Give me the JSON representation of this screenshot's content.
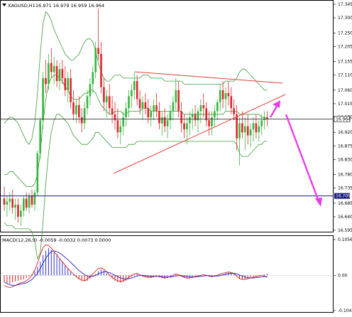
{
  "header": {
    "symbol": "XAGUSD,H1",
    "quote": "16.971 16.979 16.959 16.964"
  },
  "colors": {
    "bull": "#35b53b",
    "bear": "#e0222a",
    "bollinger": "#3a9a3a",
    "price_line": "#333333",
    "support_line": "#1a1a7e",
    "trendline": "#e83c3c",
    "forecast_arrow": "#e43ee8",
    "macd_line": "#e02020",
    "signal_line": "#2020c0",
    "hist_pos": "#3030d0",
    "hist_neg": "#d02020"
  },
  "chart_data": [
    {
      "type": "candlestick",
      "title": "XAGUSD,H1",
      "y_axis_ticks": [
        "17.345",
        "17.300",
        "17.250",
        "17.205",
        "17.155",
        "17.110",
        "17.060",
        "17.015",
        "16.970",
        "16.920",
        "16.875",
        "16.830",
        "16.780",
        "16.735",
        "16.685",
        "16.640",
        "16.595"
      ],
      "ylim": [
        16.595,
        17.345
      ],
      "current_price": 16.964,
      "current_price_label": "16.964",
      "support_level": 16.709,
      "support_label": "16.709",
      "candles_approx": [
        [
          16.7,
          16.74,
          16.66,
          16.68
        ],
        [
          16.68,
          16.71,
          16.64,
          16.69
        ],
        [
          16.69,
          16.72,
          16.66,
          16.7
        ],
        [
          16.7,
          16.73,
          16.65,
          16.67
        ],
        [
          16.67,
          16.7,
          16.63,
          16.68
        ],
        [
          16.68,
          16.7,
          16.62,
          16.64
        ],
        [
          16.64,
          16.68,
          16.61,
          16.66
        ],
        [
          16.66,
          16.71,
          16.64,
          16.7
        ],
        [
          16.7,
          16.72,
          16.66,
          16.67
        ],
        [
          16.67,
          16.72,
          16.65,
          16.71
        ],
        [
          16.71,
          16.73,
          16.67,
          16.68
        ],
        [
          16.68,
          16.73,
          16.66,
          16.72
        ],
        [
          16.72,
          16.86,
          16.71,
          16.85
        ],
        [
          16.85,
          16.97,
          16.83,
          16.96
        ],
        [
          16.96,
          17.12,
          16.93,
          17.1
        ],
        [
          17.1,
          17.16,
          17.05,
          17.08
        ],
        [
          17.08,
          17.18,
          17.06,
          17.15
        ],
        [
          17.15,
          17.2,
          17.1,
          17.12
        ],
        [
          17.12,
          17.17,
          17.08,
          17.14
        ],
        [
          17.14,
          17.16,
          17.07,
          17.09
        ],
        [
          17.09,
          17.15,
          17.06,
          17.13
        ],
        [
          17.13,
          17.16,
          17.08,
          17.1
        ],
        [
          17.1,
          17.14,
          17.04,
          17.06
        ],
        [
          17.06,
          17.12,
          17.02,
          17.1
        ],
        [
          17.1,
          17.13,
          17.0,
          17.02
        ],
        [
          17.02,
          17.06,
          16.96,
          16.98
        ],
        [
          16.98,
          17.03,
          16.95,
          17.01
        ],
        [
          17.01,
          17.04,
          16.95,
          16.97
        ],
        [
          16.97,
          17.0,
          16.92,
          16.95
        ],
        [
          16.95,
          17.02,
          16.93,
          17.0
        ],
        [
          17.0,
          17.06,
          16.98,
          17.04
        ],
        [
          17.04,
          17.1,
          17.01,
          17.08
        ],
        [
          17.08,
          17.14,
          17.05,
          17.12
        ],
        [
          17.12,
          17.22,
          17.1,
          17.2
        ],
        [
          17.2,
          17.33,
          17.16,
          17.18
        ],
        [
          17.18,
          17.22,
          17.05,
          17.07
        ],
        [
          17.07,
          17.1,
          16.99,
          17.02
        ],
        [
          17.02,
          17.06,
          16.97,
          17.04
        ],
        [
          17.04,
          17.08,
          16.98,
          17.0
        ],
        [
          17.0,
          17.04,
          16.95,
          16.98
        ],
        [
          16.98,
          17.02,
          16.93,
          16.96
        ],
        [
          16.96,
          17.0,
          16.9,
          16.92
        ],
        [
          16.92,
          16.96,
          16.88,
          16.94
        ],
        [
          16.94,
          16.99,
          16.91,
          16.97
        ],
        [
          16.97,
          17.02,
          16.94,
          17.0
        ],
        [
          17.0,
          17.06,
          16.97,
          17.04
        ],
        [
          17.04,
          17.08,
          17.0,
          17.06
        ],
        [
          17.06,
          17.12,
          17.03,
          17.09
        ],
        [
          17.09,
          17.11,
          17.01,
          17.03
        ],
        [
          17.03,
          17.06,
          16.98,
          17.0
        ],
        [
          17.0,
          17.04,
          16.96,
          17.02
        ],
        [
          17.02,
          17.05,
          16.98,
          17.0
        ],
        [
          17.0,
          17.03,
          16.95,
          16.97
        ],
        [
          16.97,
          17.01,
          16.94,
          16.99
        ],
        [
          16.99,
          17.03,
          16.96,
          17.01
        ],
        [
          17.01,
          17.05,
          16.97,
          16.99
        ],
        [
          16.99,
          17.02,
          16.93,
          16.95
        ],
        [
          16.95,
          16.99,
          16.91,
          16.97
        ],
        [
          16.97,
          17.0,
          16.92,
          16.94
        ],
        [
          16.94,
          16.98,
          16.9,
          16.96
        ],
        [
          16.96,
          17.01,
          16.93,
          16.99
        ],
        [
          16.99,
          17.04,
          16.96,
          17.02
        ],
        [
          17.02,
          17.1,
          16.99,
          17.06
        ],
        [
          17.06,
          17.09,
          16.97,
          16.99
        ],
        [
          16.99,
          17.02,
          16.92,
          16.95
        ],
        [
          16.95,
          16.98,
          16.9,
          16.93
        ],
        [
          16.93,
          16.97,
          16.88,
          16.95
        ],
        [
          16.95,
          16.99,
          16.91,
          16.97
        ],
        [
          16.97,
          17.0,
          16.93,
          16.98
        ],
        [
          16.98,
          17.01,
          16.94,
          16.96
        ],
        [
          16.96,
          17.0,
          16.92,
          16.99
        ],
        [
          16.99,
          17.03,
          16.95,
          17.01
        ],
        [
          17.01,
          17.05,
          16.97,
          17.0
        ],
        [
          17.0,
          17.02,
          16.94,
          16.96
        ],
        [
          16.96,
          16.99,
          16.91,
          16.94
        ],
        [
          16.94,
          16.99,
          16.91,
          16.97
        ],
        [
          16.97,
          17.01,
          16.94,
          16.99
        ],
        [
          16.99,
          17.03,
          16.96,
          17.02
        ],
        [
          17.02,
          17.08,
          16.99,
          17.06
        ],
        [
          17.06,
          17.09,
          17.0,
          17.03
        ],
        [
          17.03,
          17.07,
          16.99,
          17.05
        ],
        [
          17.05,
          17.09,
          17.01,
          17.04
        ],
        [
          17.04,
          17.07,
          16.98,
          17.0
        ],
        [
          17.0,
          17.03,
          16.96,
          16.98
        ],
        [
          16.98,
          17.01,
          16.86,
          16.9
        ],
        [
          16.9,
          16.97,
          16.81,
          16.95
        ],
        [
          16.95,
          16.99,
          16.9,
          16.92
        ],
        [
          16.92,
          16.97,
          16.86,
          16.94
        ],
        [
          16.94,
          16.98,
          16.88,
          16.91
        ],
        [
          16.91,
          16.95,
          16.87,
          16.93
        ],
        [
          16.93,
          16.97,
          16.89,
          16.95
        ],
        [
          16.95,
          16.98,
          16.9,
          16.92
        ],
        [
          16.92,
          16.96,
          16.89,
          16.94
        ],
        [
          16.94,
          16.98,
          16.91,
          16.96
        ],
        [
          16.96,
          16.99,
          16.93,
          16.97
        ],
        [
          16.97,
          16.99,
          16.94,
          16.964
        ]
      ],
      "bollinger_upper_approx": [
        16.95,
        16.96,
        16.97,
        16.97,
        16.96,
        16.95,
        16.93,
        16.91,
        16.89,
        16.88,
        16.9,
        16.95,
        17.05,
        17.18,
        17.28,
        17.32,
        17.31,
        17.29,
        17.26,
        17.24,
        17.22,
        17.2,
        17.18,
        17.17,
        17.16,
        17.16,
        17.17,
        17.18,
        17.2,
        17.22,
        17.23,
        17.23,
        17.22,
        17.19,
        17.15,
        17.12,
        17.1,
        17.09,
        17.09,
        17.1,
        17.11,
        17.11,
        17.11,
        17.1,
        17.1,
        17.1,
        17.1,
        17.1,
        17.1,
        17.1,
        17.11,
        17.11,
        17.11,
        17.1,
        17.1,
        17.1,
        17.1,
        17.1,
        17.09,
        17.09,
        17.09,
        17.09,
        17.09,
        17.09,
        17.09,
        17.08,
        17.08,
        17.08,
        17.08,
        17.08,
        17.08,
        17.08,
        17.08,
        17.08,
        17.08,
        17.08,
        17.08,
        17.08,
        17.08,
        17.08,
        17.09,
        17.09,
        17.09,
        17.09,
        17.1,
        17.12,
        17.13,
        17.13,
        17.12,
        17.11,
        17.1,
        17.09,
        17.08,
        17.07,
        17.06,
        17.06
      ],
      "bollinger_lower_approx": [
        16.62,
        16.61,
        16.61,
        16.61,
        16.6,
        16.6,
        16.6,
        16.6,
        16.6,
        16.6,
        16.59,
        16.56,
        16.5,
        16.52,
        16.62,
        16.75,
        16.85,
        16.92,
        16.96,
        16.98,
        16.98,
        16.97,
        16.96,
        16.95,
        16.93,
        16.91,
        16.9,
        16.89,
        16.88,
        16.88,
        16.88,
        16.89,
        16.9,
        16.92,
        16.92,
        16.91,
        16.9,
        16.89,
        16.88,
        16.87,
        16.87,
        16.87,
        16.87,
        16.87,
        16.87,
        16.88,
        16.88,
        16.88,
        16.89,
        16.89,
        16.89,
        16.89,
        16.89,
        16.89,
        16.89,
        16.89,
        16.89,
        16.89,
        16.89,
        16.89,
        16.89,
        16.89,
        16.89,
        16.89,
        16.89,
        16.89,
        16.89,
        16.89,
        16.89,
        16.89,
        16.89,
        16.89,
        16.89,
        16.89,
        16.89,
        16.89,
        16.89,
        16.89,
        16.89,
        16.89,
        16.89,
        16.89,
        16.89,
        16.89,
        16.88,
        16.85,
        16.84,
        16.84,
        16.84,
        16.85,
        16.86,
        16.87,
        16.88,
        16.88,
        16.89,
        16.89
      ],
      "bollinger_middle_approx": [
        16.78,
        16.78,
        16.79,
        16.79,
        16.78,
        16.77,
        16.76,
        16.75,
        16.74,
        16.74,
        16.74,
        16.75,
        16.78,
        16.85,
        16.95,
        17.03,
        17.08,
        17.1,
        17.11,
        17.11,
        17.1,
        17.09,
        17.07,
        17.06,
        17.04,
        17.03,
        17.03,
        17.03,
        17.04,
        17.05,
        17.05,
        17.06,
        17.06,
        17.05,
        17.03,
        17.01,
        17.0,
        16.99,
        16.98,
        16.98,
        16.99,
        16.99,
        16.99,
        16.98,
        16.98,
        16.99,
        16.99,
        16.99,
        16.99,
        16.99,
        17.0,
        17.0,
        17.0,
        16.99,
        16.99,
        16.99,
        16.99,
        16.99,
        16.99,
        16.99,
        16.99,
        16.99,
        16.99,
        16.99,
        16.99,
        16.98,
        16.98,
        16.98,
        16.98,
        16.98,
        16.98,
        16.98,
        16.98,
        16.98,
        16.98,
        16.98,
        16.98,
        16.98,
        16.98,
        16.98,
        16.99,
        16.99,
        16.99,
        16.99,
        16.99,
        16.98,
        16.98,
        16.98,
        16.98,
        16.98,
        16.98,
        16.98,
        16.98,
        16.97,
        16.97,
        16.97
      ]
    },
    {
      "type": "macd",
      "title": "MACD(12,26,9) -0.0059 -0.0032 0.0073 0.0000",
      "y_axis_ticks": [
        "0.1056",
        "0.00",
        "-0.1042"
      ],
      "ylim": [
        -0.1042,
        0.1056
      ],
      "zero_label": "0.00",
      "histogram_approx": [
        -0.02,
        -0.022,
        -0.024,
        -0.02,
        -0.018,
        -0.016,
        -0.014,
        -0.012,
        -0.008,
        -0.004,
        0.004,
        0.012,
        0.025,
        0.04,
        0.06,
        0.072,
        0.08,
        0.075,
        0.068,
        0.06,
        0.05,
        0.04,
        0.03,
        0.02,
        0.01,
        0.002,
        -0.006,
        -0.012,
        -0.016,
        -0.018,
        -0.016,
        -0.01,
        -0.004,
        0.004,
        0.012,
        0.018,
        0.014,
        0.006,
        -0.002,
        -0.01,
        -0.016,
        -0.02,
        -0.022,
        -0.02,
        -0.016,
        -0.01,
        -0.004,
        0.002,
        0.004,
        0.0,
        -0.004,
        -0.006,
        -0.008,
        -0.008,
        -0.006,
        -0.004,
        -0.006,
        -0.008,
        -0.01,
        -0.008,
        -0.006,
        -0.002,
        0.002,
        0.0,
        -0.004,
        -0.008,
        -0.01,
        -0.01,
        -0.008,
        -0.006,
        -0.004,
        -0.002,
        0.0,
        -0.002,
        -0.004,
        -0.006,
        -0.004,
        -0.002,
        0.002,
        0.004,
        0.006,
        0.008,
        0.006,
        0.004,
        -0.004,
        -0.01,
        -0.012,
        -0.012,
        -0.01,
        -0.008,
        -0.006,
        -0.004,
        -0.002,
        0.0,
        0.002,
        0.004
      ],
      "macd_line_approx": [
        -0.03,
        -0.034,
        -0.036,
        -0.034,
        -0.03,
        -0.026,
        -0.022,
        -0.02,
        -0.016,
        -0.01,
        0.0,
        0.015,
        0.035,
        0.06,
        0.082,
        0.09,
        0.088,
        0.08,
        0.07,
        0.06,
        0.05,
        0.04,
        0.03,
        0.02,
        0.012,
        0.004,
        -0.004,
        -0.01,
        -0.014,
        -0.016,
        -0.012,
        -0.004,
        0.004,
        0.012,
        0.02,
        0.022,
        0.018,
        0.01,
        0.002,
        -0.006,
        -0.012,
        -0.016,
        -0.018,
        -0.016,
        -0.012,
        -0.006,
        0.0,
        0.004,
        0.006,
        0.002,
        -0.002,
        -0.004,
        -0.006,
        -0.006,
        -0.004,
        -0.002,
        -0.004,
        -0.006,
        -0.008,
        -0.006,
        -0.004,
        0.0,
        0.004,
        0.002,
        -0.002,
        -0.006,
        -0.008,
        -0.008,
        -0.006,
        -0.004,
        -0.002,
        0.0,
        0.002,
        0.0,
        -0.002,
        -0.004,
        -0.002,
        0.0,
        0.004,
        0.006,
        0.008,
        0.01,
        0.008,
        0.006,
        -0.002,
        -0.01,
        -0.012,
        -0.012,
        -0.01,
        -0.008,
        -0.006,
        -0.004,
        -0.002,
        0.0,
        -0.002,
        -0.006
      ],
      "signal_line_approx": [
        -0.02,
        -0.024,
        -0.028,
        -0.03,
        -0.03,
        -0.028,
        -0.026,
        -0.024,
        -0.022,
        -0.018,
        -0.012,
        -0.004,
        0.006,
        0.02,
        0.036,
        0.05,
        0.062,
        0.07,
        0.072,
        0.07,
        0.066,
        0.06,
        0.053,
        0.046,
        0.038,
        0.03,
        0.022,
        0.014,
        0.008,
        0.002,
        -0.002,
        -0.004,
        -0.003,
        0.0,
        0.004,
        0.008,
        0.01,
        0.01,
        0.008,
        0.004,
        0.0,
        -0.004,
        -0.008,
        -0.01,
        -0.011,
        -0.01,
        -0.008,
        -0.005,
        -0.002,
        0.0,
        0.0,
        -0.001,
        -0.002,
        -0.003,
        -0.003,
        -0.003,
        -0.003,
        -0.004,
        -0.005,
        -0.005,
        -0.005,
        -0.004,
        -0.002,
        -0.001,
        -0.001,
        -0.002,
        -0.003,
        -0.004,
        -0.005,
        -0.005,
        -0.004,
        -0.003,
        -0.002,
        -0.001,
        -0.001,
        -0.002,
        -0.002,
        -0.002,
        -0.001,
        0.001,
        0.003,
        0.005,
        0.006,
        0.006,
        0.004,
        0.001,
        -0.002,
        -0.005,
        -0.007,
        -0.008,
        -0.008,
        -0.007,
        -0.006,
        -0.005,
        -0.004,
        -0.004
      ]
    }
  ]
}
